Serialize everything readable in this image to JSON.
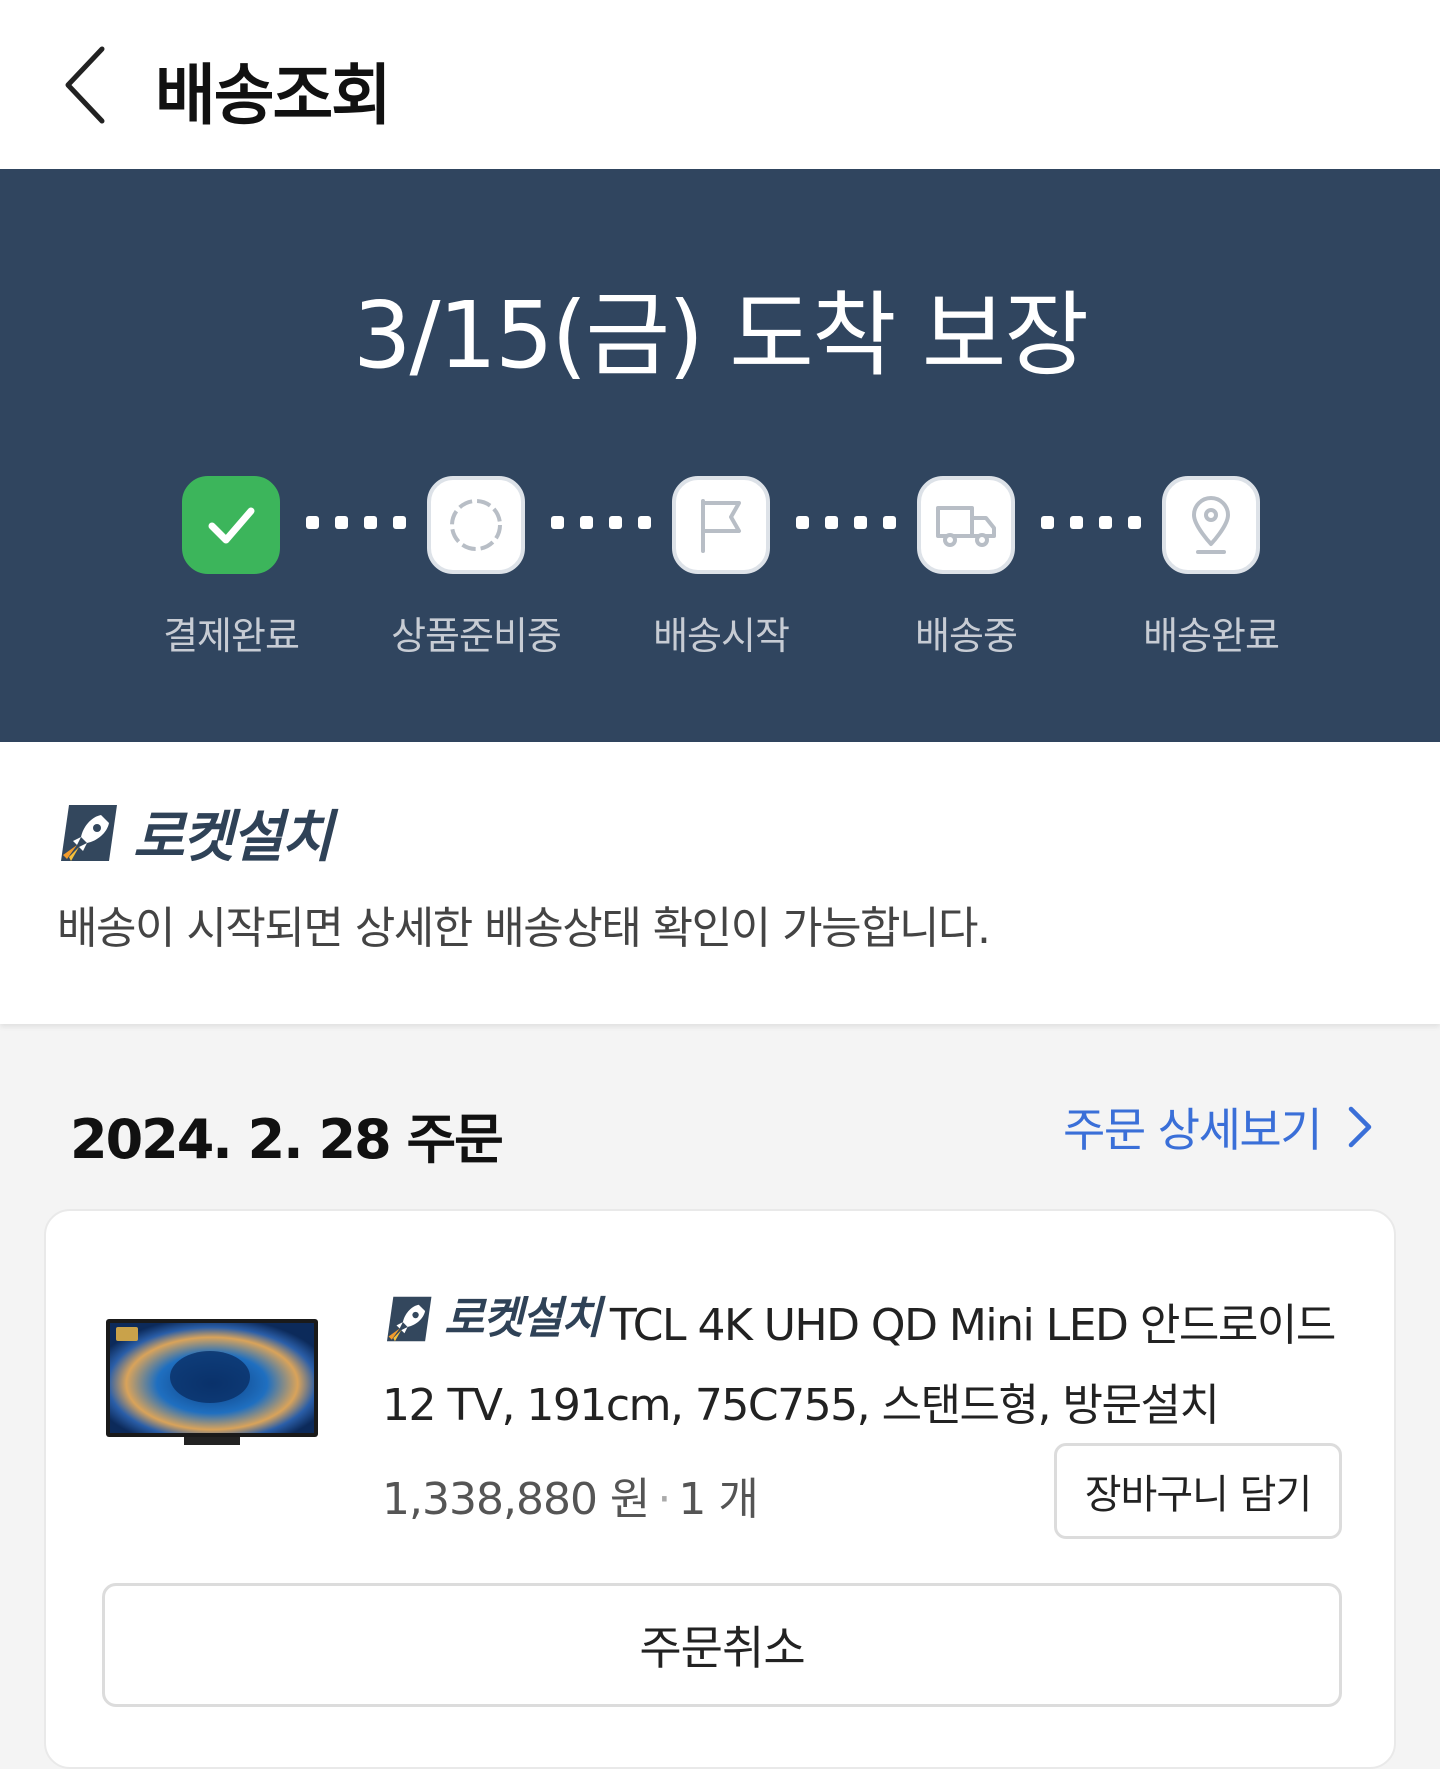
{
  "header": {
    "title": "배송조회",
    "back_icon": "chevron-left-icon"
  },
  "delivery": {
    "eta": "3/15(금) 도착 보장",
    "steps": [
      {
        "label": "결제완료",
        "icon": "check-icon",
        "state": "done"
      },
      {
        "label": "상품준비중",
        "icon": "loading-circle-icon",
        "state": "pending"
      },
      {
        "label": "배송시작",
        "icon": "flag-icon",
        "state": "pending"
      },
      {
        "label": "배송중",
        "icon": "truck-icon",
        "state": "pending"
      },
      {
        "label": "배송완료",
        "icon": "location-pin-icon",
        "state": "pending"
      }
    ]
  },
  "install": {
    "badge": "로켓설치",
    "description": "배송이 시작되면 상세한 배송상태 확인이 가능합니다."
  },
  "order": {
    "date": "2024. 2. 28 주문",
    "detail_link": "주문 상세보기",
    "product": {
      "badge": "로켓설치",
      "name": "TCL 4K UHD QD Mini LED 안드로이드12 TV, 191cm, 75C755, 스탠드형, 방문설치",
      "price": "1,338,880 원",
      "separator": "·",
      "quantity": "1 개",
      "image_icon": "tv-product-image"
    },
    "cart_button": "장바구니 담기",
    "cancel_button": "주문취소"
  },
  "colors": {
    "hero_bg": "#30455f",
    "done_green": "#3cb55b",
    "link_blue": "#3a6fd8",
    "badge_navy": "#2f4257"
  }
}
